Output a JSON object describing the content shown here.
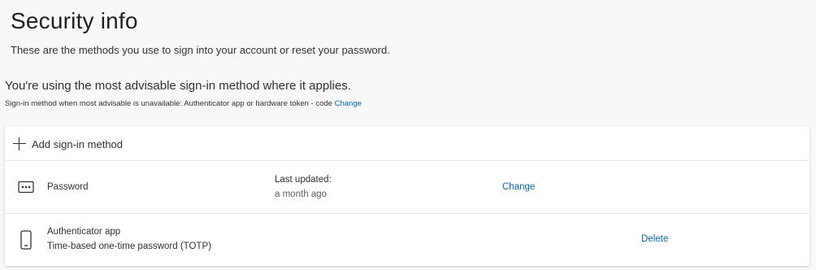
{
  "header": {
    "title": "Security info",
    "subtitle": "These are the methods you use to sign into your account or reset your password."
  },
  "advisory": {
    "status_text": "You're using the most advisable sign-in method where it applies.",
    "fallback_text": "Sign-in method when most advisable is unavailable: Authenticator app or hardware token - code",
    "fallback_change_link": "Change"
  },
  "methods_card": {
    "add_label": "Add sign-in method",
    "methods": [
      {
        "icon": "password-dots-icon",
        "name": "Password",
        "updated_label": "Last updated:",
        "updated_value": "a month ago",
        "action": "Change"
      },
      {
        "icon": "phone-icon",
        "name": "Authenticator app",
        "detail": "Time-based one-time password (TOTP)",
        "action": "Delete"
      }
    ]
  },
  "colors": {
    "background": "#f8f8f8",
    "link": "#0067b8",
    "text": "#323130"
  }
}
